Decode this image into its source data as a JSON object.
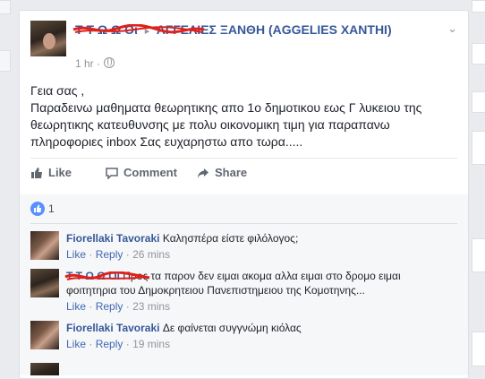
{
  "post": {
    "author": "Τ Τ Ω Ω Οι",
    "arrow": "▸",
    "group": "ΑΓΓΕΛΙΕΣ ΞΑΝΘΗ (AGGELIES XANTHI)",
    "time": "1 hr ·",
    "text_line1": "Γεια σας ,",
    "text_line2": "Παραδεινω μαθηματα θεωρητικης απο 1ο δημοτικου εως Γ λυκειου της θεωρητικης κατευθυνσης με πολυ οικονομικη τιμη για παραπανω πληροφοριες inbox Σας ευχαρηστω απο τωρα.....",
    "actions": {
      "like": "Like",
      "comment": "Comment",
      "share": "Share"
    },
    "likes_count": "1"
  },
  "comments": [
    {
      "name": "Fiorellaki Tavoraki",
      "text": "Καλησπέρα είστε φιλόλογος;",
      "like": "Like",
      "sep": "·",
      "reply": "Reply",
      "time": "26 mins"
    },
    {
      "name": "Τ Τ Ω Ω Οι",
      "text": "Προς τα παρον δεν ειμαι ακομα αλλα ειμαι στο δρομο ειμαι φοιτητηρια του Δημοκρητειου Πανεπιστημειου της Κομοτηνης...",
      "like": "Like",
      "sep": "·",
      "reply": "Reply",
      "time": "23 mins"
    },
    {
      "name": "Fiorellaki Tavoraki",
      "text": "Δε φαίνεται συγγνώμη κιόλας",
      "like": "Like",
      "sep": "·",
      "reply": "Reply",
      "time": "19 mins"
    }
  ],
  "colors": {
    "link": "#365899",
    "like_blue": "#5890ff",
    "muted": "#90949c"
  }
}
